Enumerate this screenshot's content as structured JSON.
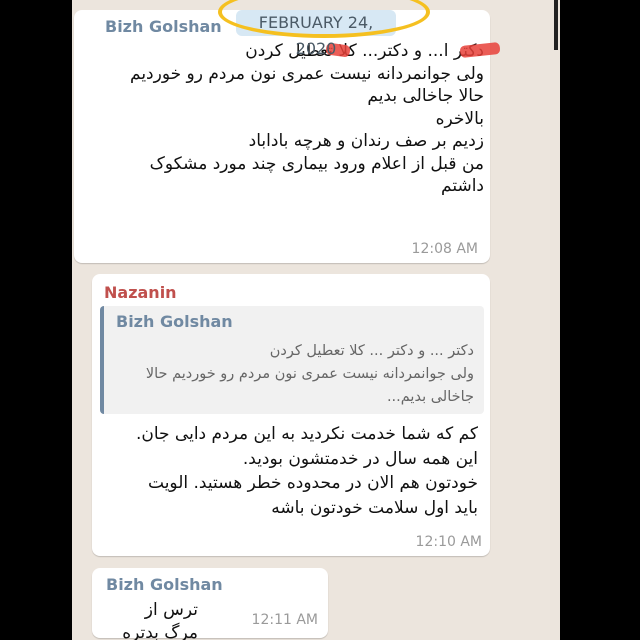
{
  "date_label": "FEBRUARY 24, 2020",
  "messages": [
    {
      "sender": "Bizh Golshan",
      "text": "دکتر ا... و دکتر... کلا تعطیل کردن\nولی جوانمردانه نیست عمری نون مردم رو خوردیم\nحالا جاخالی بدیم\nبالاخره\nزدیم بر صف رندان و هرچه باداباد\nمن قبل از اعلام ورود بیماری چند مورد مشکوک\nداشتم",
      "time": "12:08 AM"
    },
    {
      "sender": "Nazanin",
      "quote": {
        "sender": "Bizh Golshan",
        "text": "دکتر ... و دکتر ... کلا تعطیل کردن\nولی جوانمردانه نیست عمری نون مردم رو خوردیم حالا\nجاخالی بدیم..."
      },
      "text": "کم که شما خدمت نکردید به این مردم دایی جان.\nاین همه سال در خدمتشون بودید.\nخودتون هم الان در محدوده خطر هستید. الویت\nباید اول سلامت خودتون باشه",
      "time": "12:10 AM"
    },
    {
      "sender": "Bizh Golshan",
      "text": "ترس از مرگ بدتره",
      "time": "12:11 AM"
    }
  ],
  "colors": {
    "background": "#ece5dd",
    "sender_blue": "#7089a2",
    "sender_red": "#c0504d",
    "highlight": "#f5c020"
  }
}
